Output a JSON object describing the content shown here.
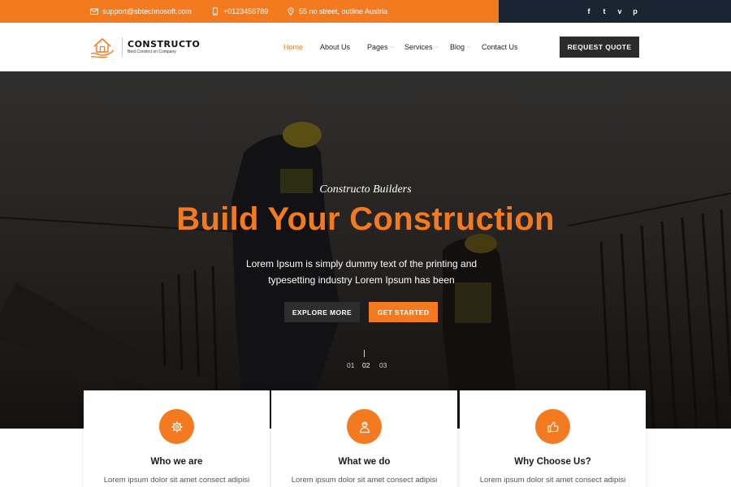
{
  "topbar": {
    "email": "support@sbtechnosoft.com",
    "phone": "+0123456789",
    "address": "55 no street, outline Austria",
    "social": [
      "f",
      "t",
      "v",
      "p"
    ],
    "icons": {
      "email": "envelope-icon",
      "phone": "phone-icon",
      "address": "map-pin-icon"
    }
  },
  "brand": {
    "name": "CONSTRUCTO",
    "tagline": "Best Constrct on Company",
    "logo_icon": "house-hand-logo"
  },
  "nav": {
    "items": [
      {
        "label": "Home",
        "active": true,
        "dropdown": false
      },
      {
        "label": "About Us",
        "active": false,
        "dropdown": false
      },
      {
        "label": "Pages",
        "active": false,
        "dropdown": true
      },
      {
        "label": "Services",
        "active": false,
        "dropdown": true
      },
      {
        "label": "Blog",
        "active": false,
        "dropdown": true
      },
      {
        "label": "Contact Us",
        "active": false,
        "dropdown": false
      }
    ],
    "cta": "REQUEST QUOTE"
  },
  "hero": {
    "subtitle": "Constructo Builders",
    "title": "Build Your Construction",
    "description_line1": "Lorem Ipsum is simply dummy text of the printing and",
    "description_line2": "typesetting industry Lorem Ipsum has been",
    "buttons": {
      "explore": "EXPLORE MORE",
      "start": "GET STARTED"
    },
    "slides": [
      "01",
      "02",
      "03"
    ],
    "active_slide": "02"
  },
  "features": [
    {
      "title": "Who we are",
      "text": "Lorem ipsum dolor sit amet consect adipisi",
      "icon": "gear-icon"
    },
    {
      "title": "What we do",
      "text": "Lorem ipsum dolor sit amet consect adipisi",
      "icon": "worker-icon"
    },
    {
      "title": "Why Choose Us?",
      "text": "Lorem ipsum dolor sit amet consect adipisi",
      "icon": "thumbs-up-icon"
    }
  ],
  "colors": {
    "accent": "#f47a20",
    "dark": "#1b2432",
    "button_dark": "#2b2b2b"
  }
}
